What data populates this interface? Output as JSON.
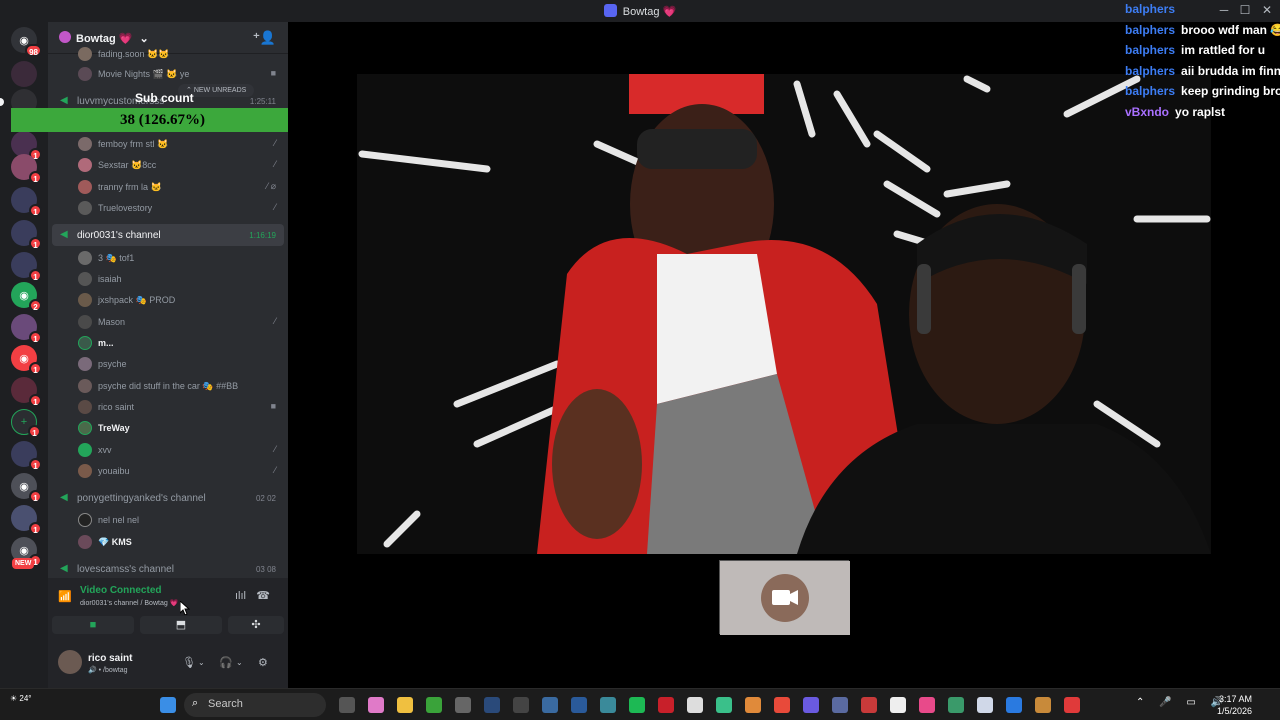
{
  "window": {
    "title": "Bowtag 💗"
  },
  "server": {
    "name": "Bowtag 💗"
  },
  "pills": {
    "new_unreads": "NEW UNREADS"
  },
  "rail": {
    "badges": [
      "98",
      "1",
      "1",
      "1",
      "1",
      "1",
      "1",
      "1",
      "2",
      "1",
      "1",
      "1",
      "1",
      "1",
      "1",
      "1",
      "1",
      "NEW"
    ]
  },
  "voice_channels": [
    {
      "name": "luvvmycustomersss",
      "time": "1:25:11"
    },
    {
      "name": "dior0031's channel",
      "time": "1:16:19"
    },
    {
      "name": "ponygettingyanked's channel",
      "time": "02  02"
    },
    {
      "name": "lovescamss's channel",
      "time": "03  08"
    }
  ],
  "members_top": [
    {
      "name": "fading.soon 🐱🐱"
    },
    {
      "name": "Movie Nights 🎬 🐱 ye"
    }
  ],
  "members_luvv": [
    {
      "name": "femboy frm stl 🐱"
    },
    {
      "name": "Sexstar 🐱8cc"
    },
    {
      "name": "tranny frm la 🐱"
    },
    {
      "name": "Truelovestory"
    }
  ],
  "members_dior": [
    {
      "name": "3  🎭 tof1"
    },
    {
      "name": "isaiah"
    },
    {
      "name": "jxshpack  🎭 PROD"
    },
    {
      "name": "Mason"
    },
    {
      "name": "m..."
    },
    {
      "name": "psyche"
    },
    {
      "name": "psyche did stuff in the car  🎭 ##BB"
    },
    {
      "name": "rico saint"
    },
    {
      "name": "TreWay"
    },
    {
      "name": "xvv"
    },
    {
      "name": "youaibu"
    }
  ],
  "members_pony": [
    {
      "name": "nel nel nel"
    },
    {
      "name": "💎 KMS"
    }
  ],
  "overlay": {
    "title": "Sub count",
    "value": "38 (126.67%)",
    "side": "30"
  },
  "voice_status": {
    "label": "Video Connected",
    "location": "dior0031's channel / Bowtag 💗"
  },
  "user": {
    "name": "rico saint",
    "status": "🔊 • /bowtag"
  },
  "chat": [
    {
      "author": "balphers",
      "text": ""
    },
    {
      "author": "balphers",
      "text": "brooo wdf man 😂"
    },
    {
      "author": "balphers",
      "text": "im rattled for u"
    },
    {
      "author": "balphers",
      "text": "aii brudda im finna"
    },
    {
      "author": "balphers",
      "text": "keep grinding brosk"
    },
    {
      "author": "vBxndo",
      "text": "yo raplst"
    }
  ],
  "taskbar": {
    "weather": "24°",
    "search": "Search",
    "time": "3:17 AM",
    "date": "1/5/2026"
  },
  "colors": {
    "accent": "#23a55a",
    "overlay_bar": "#3ca83c",
    "chat_author": "#3d7df4",
    "chat_author_alt": "#a970ff"
  }
}
